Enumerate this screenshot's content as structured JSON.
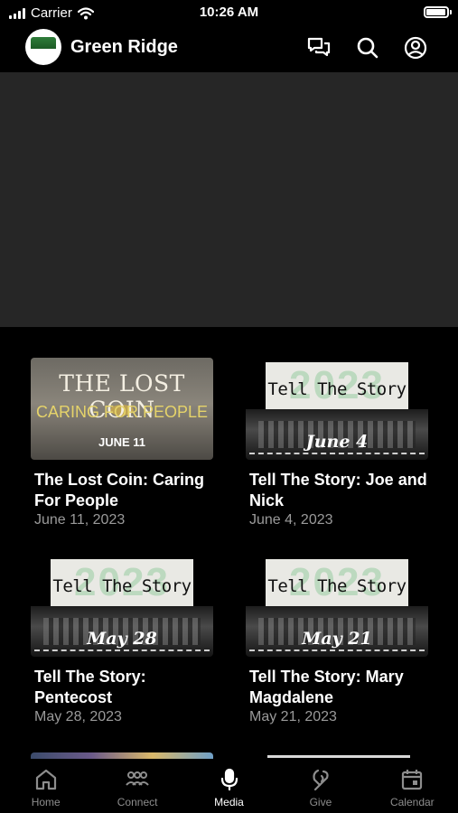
{
  "status_bar": {
    "carrier": "Carrier",
    "time": "10:26 AM"
  },
  "header": {
    "title": "Green Ridge",
    "icons": [
      "chat-icon",
      "search-icon",
      "account-icon"
    ]
  },
  "media": [
    {
      "title": "The Lost Coin: Caring For People",
      "date": "June 11, 2023",
      "thumb": {
        "style": "coin",
        "line1": "THE LOST COIN",
        "line2": "CARING FOR PEOPLE",
        "line3": "JUNE 11"
      }
    },
    {
      "title": "Tell The Story: Joe and Nick",
      "date": "June 4, 2023",
      "thumb": {
        "style": "story",
        "year": "2023",
        "label": "Tell The Story",
        "when": "June 4"
      }
    },
    {
      "title": "Tell The Story: Pentecost",
      "date": "May 28, 2023",
      "thumb": {
        "style": "story",
        "year": "2023",
        "label": "Tell The Story",
        "when": "May 28"
      }
    },
    {
      "title": "Tell The Story: Mary Magdalene",
      "date": "May 21, 2023",
      "thumb": {
        "style": "story",
        "year": "2023",
        "label": "Tell The Story",
        "when": "May 21"
      }
    }
  ],
  "tabs": [
    {
      "label": "Home",
      "icon": "home-icon",
      "active": false
    },
    {
      "label": "Connect",
      "icon": "people-icon",
      "active": false
    },
    {
      "label": "Media",
      "icon": "microphone-icon",
      "active": true
    },
    {
      "label": "Give",
      "icon": "give-icon",
      "active": false
    },
    {
      "label": "Calendar",
      "icon": "calendar-icon",
      "active": false
    }
  ]
}
